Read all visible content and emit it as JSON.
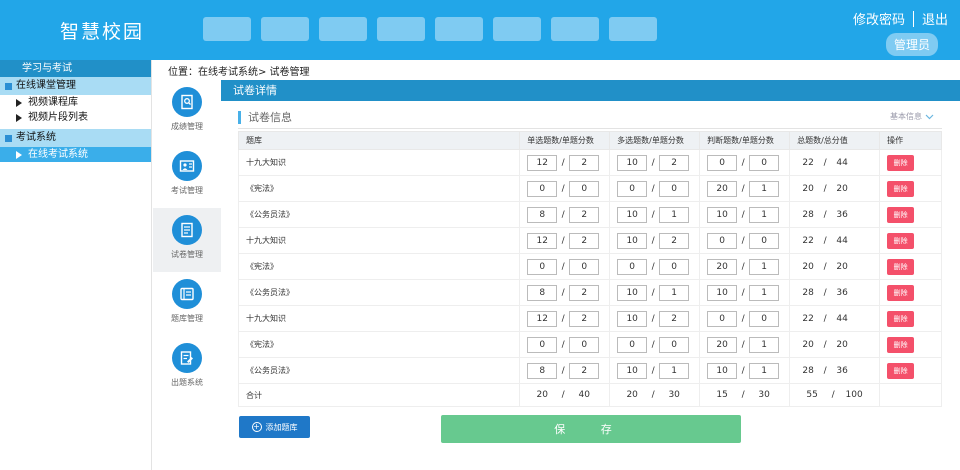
{
  "header": {
    "brand": "智慧校园",
    "nav_count": 8,
    "change_password": "修改密码",
    "logout": "退出",
    "role": "管理员"
  },
  "sidebar": {
    "title": "学习与考试",
    "groups": [
      {
        "label": "在线课堂管理",
        "items": [
          "视频课程库",
          "视频片段列表"
        ]
      },
      {
        "label": "考试系统",
        "items": [
          "在线考试系统"
        ]
      }
    ]
  },
  "breadcrumb": "位置：在线考试系统> 试卷管理",
  "icon_nav": [
    {
      "label": "成绩管理",
      "icon": "grade-icon"
    },
    {
      "label": "考试管理",
      "icon": "exam-icon"
    },
    {
      "label": "试卷管理",
      "icon": "paper-icon"
    },
    {
      "label": "题库管理",
      "icon": "question-bank-icon"
    },
    {
      "label": "出题系统",
      "icon": "compose-icon"
    }
  ],
  "panel": {
    "title": "试卷详情",
    "card_title": "试卷信息",
    "basic_info": "基本信息"
  },
  "table": {
    "headers": [
      "题库",
      "单选题数/单题分数",
      "多选题数/单题分数",
      "判断题数/单题分数",
      "总题数/总分值",
      "操作"
    ],
    "rows": [
      {
        "name": "十九大知识",
        "single": [
          "12",
          "2"
        ],
        "multi": [
          "10",
          "2"
        ],
        "judge": [
          "0",
          "0"
        ],
        "total": [
          "22",
          "44"
        ]
      },
      {
        "name": "《宪法》",
        "single": [
          "0",
          "0"
        ],
        "multi": [
          "0",
          "0"
        ],
        "judge": [
          "20",
          "1"
        ],
        "total": [
          "20",
          "20"
        ]
      },
      {
        "name": "《公务员法》",
        "single": [
          "8",
          "2"
        ],
        "multi": [
          "10",
          "1"
        ],
        "judge": [
          "10",
          "1"
        ],
        "total": [
          "28",
          "36"
        ]
      },
      {
        "name": "十九大知识",
        "single": [
          "12",
          "2"
        ],
        "multi": [
          "10",
          "2"
        ],
        "judge": [
          "0",
          "0"
        ],
        "total": [
          "22",
          "44"
        ]
      },
      {
        "name": "《宪法》",
        "single": [
          "0",
          "0"
        ],
        "multi": [
          "0",
          "0"
        ],
        "judge": [
          "20",
          "1"
        ],
        "total": [
          "20",
          "20"
        ]
      },
      {
        "name": "《公务员法》",
        "single": [
          "8",
          "2"
        ],
        "multi": [
          "10",
          "1"
        ],
        "judge": [
          "10",
          "1"
        ],
        "total": [
          "28",
          "36"
        ]
      },
      {
        "name": "十九大知识",
        "single": [
          "12",
          "2"
        ],
        "multi": [
          "10",
          "2"
        ],
        "judge": [
          "0",
          "0"
        ],
        "total": [
          "22",
          "44"
        ]
      },
      {
        "name": "《宪法》",
        "single": [
          "0",
          "0"
        ],
        "multi": [
          "0",
          "0"
        ],
        "judge": [
          "20",
          "1"
        ],
        "total": [
          "20",
          "20"
        ]
      },
      {
        "name": "《公务员法》",
        "single": [
          "8",
          "2"
        ],
        "multi": [
          "10",
          "1"
        ],
        "judge": [
          "10",
          "1"
        ],
        "total": [
          "28",
          "36"
        ]
      }
    ],
    "delete_label": "删除",
    "total_row": {
      "label": "合计",
      "single": [
        "20",
        "40"
      ],
      "multi": [
        "20",
        "30"
      ],
      "judge": [
        "15",
        "30"
      ],
      "total": [
        "55",
        "100"
      ]
    }
  },
  "actions": {
    "add_label": "添加题库",
    "save_label": "保 存"
  }
}
